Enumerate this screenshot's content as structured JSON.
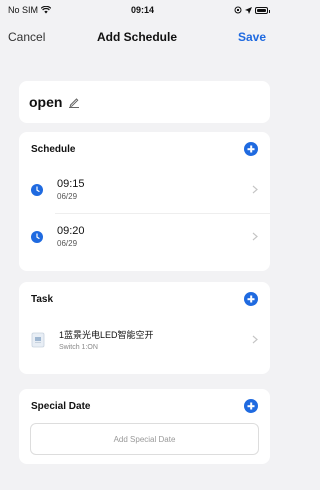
{
  "status_bar": {
    "carrier": "No SIM",
    "time": "09:14"
  },
  "nav": {
    "cancel_label": "Cancel",
    "title": "Add Schedule",
    "save_label": "Save"
  },
  "name_card": {
    "name": "open"
  },
  "schedule": {
    "title": "Schedule",
    "items": [
      {
        "time": "09:15",
        "date": "06/29"
      },
      {
        "time": "09:20",
        "date": "06/29"
      }
    ]
  },
  "task": {
    "title": "Task",
    "items": [
      {
        "name": "1蓝景光电LED智能空开",
        "detail": "Switch 1:ON"
      }
    ]
  },
  "special_date": {
    "title": "Special Date",
    "add_label": "Add Special Date"
  },
  "colors": {
    "accent": "#1f6ae0",
    "background": "#f2f2f4"
  }
}
